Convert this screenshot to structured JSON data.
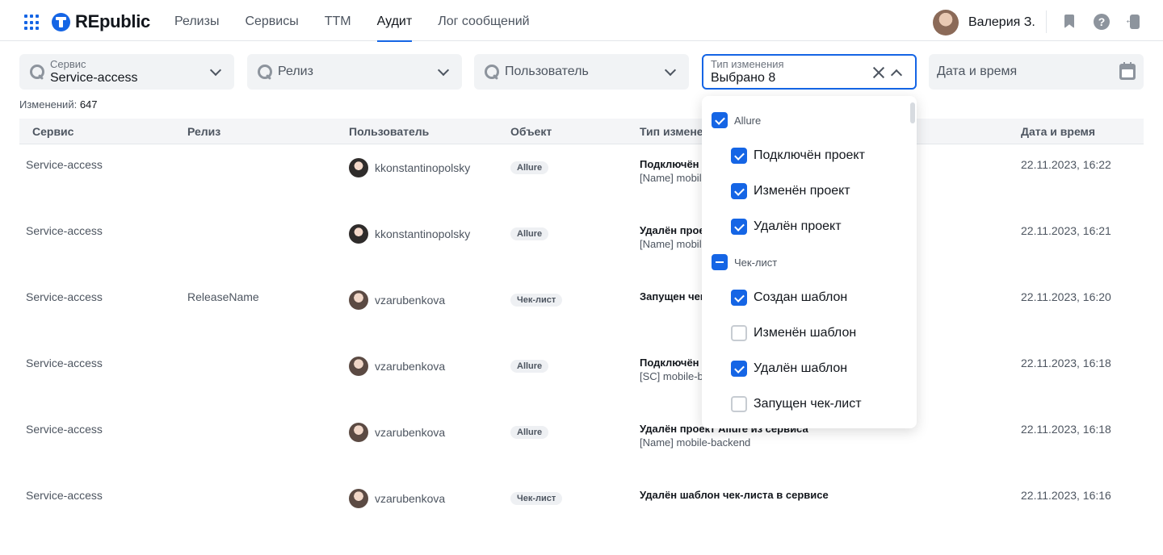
{
  "header": {
    "logo_text": "REpublic",
    "nav": [
      {
        "label": "Релизы",
        "active": false
      },
      {
        "label": "Сервисы",
        "active": false
      },
      {
        "label": "ТТМ",
        "active": false
      },
      {
        "label": "Аудит",
        "active": true
      },
      {
        "label": "Лог сообщений",
        "active": false
      }
    ],
    "user_name": "Валерия З.",
    "icons": [
      "apps-grid-icon",
      "republic-logo-icon",
      "bookmark-icon",
      "help-icon",
      "logout-icon"
    ]
  },
  "filters": {
    "service": {
      "label": "Сервис",
      "value": "Service-access"
    },
    "release": {
      "placeholder": "Релиз"
    },
    "user": {
      "placeholder": "Пользователь"
    },
    "change_type": {
      "label": "Тип изменения",
      "value": "Выбрано 8"
    },
    "datetime": {
      "placeholder": "Дата и время"
    }
  },
  "changes": {
    "label": "Изменений:",
    "count": "647"
  },
  "table": {
    "columns": [
      "Сервис",
      "Релиз",
      "Пользователь",
      "Объект",
      "Тип изменения",
      "Дата и время"
    ],
    "rows": [
      {
        "service": "Service-access",
        "release": "",
        "user": "kkonstantinopolsky",
        "object": "Allure",
        "type_title": "Подключён проект Allure к сервису",
        "type_detail": "[Name] mobile-backend",
        "datetime": "22.11.2023, 16:22"
      },
      {
        "service": "Service-access",
        "release": "",
        "user": "kkonstantinopolsky",
        "object": "Allure",
        "type_title": "Удалён проект Allure из сервиса",
        "type_detail": "[Name] mobile-backend",
        "datetime": "22.11.2023, 16:21"
      },
      {
        "service": "Service-access",
        "release": "ReleaseName",
        "user": "vzarubenkova",
        "object": "Чек-лист",
        "type_title": "Запущен чек-лист",
        "type_detail": "",
        "datetime": "22.11.2023, 16:20"
      },
      {
        "service": "Service-access",
        "release": "",
        "user": "vzarubenkova",
        "object": "Allure",
        "type_title": "Подключён проект Allure к сервису",
        "type_detail": "[SC] mobile-backend",
        "datetime": "22.11.2023, 16:18"
      },
      {
        "service": "Service-access",
        "release": "",
        "user": "vzarubenkova",
        "object": "Allure",
        "type_title": "Удалён проект Allure из сервиса",
        "type_detail": "[Name] mobile-backend",
        "datetime": "22.11.2023, 16:18"
      },
      {
        "service": "Service-access",
        "release": "",
        "user": "vzarubenkova",
        "object": "Чек-лист",
        "type_title": "Удалён шаблон чек-листа в сервисе",
        "type_detail": "",
        "datetime": "22.11.2023, 16:16"
      }
    ]
  },
  "dropdown": {
    "items": [
      {
        "label": "Allure",
        "group": true,
        "state": "checked"
      },
      {
        "label": "Подключён проект",
        "group": false,
        "state": "checked"
      },
      {
        "label": "Изменён проект",
        "group": false,
        "state": "checked"
      },
      {
        "label": "Удалён проект",
        "group": false,
        "state": "checked"
      },
      {
        "label": "Чек-лист",
        "group": true,
        "state": "partial"
      },
      {
        "label": "Создан шаблон",
        "group": false,
        "state": "checked"
      },
      {
        "label": "Изменён шаблон",
        "group": false,
        "state": "unchecked"
      },
      {
        "label": "Удалён шаблон",
        "group": false,
        "state": "checked"
      },
      {
        "label": "Запущен чек-лист",
        "group": false,
        "state": "unchecked"
      }
    ]
  },
  "colors": {
    "accent": "#1565e5",
    "badge_bg": "#eef0f3",
    "header_border": "#e3e6ea"
  }
}
